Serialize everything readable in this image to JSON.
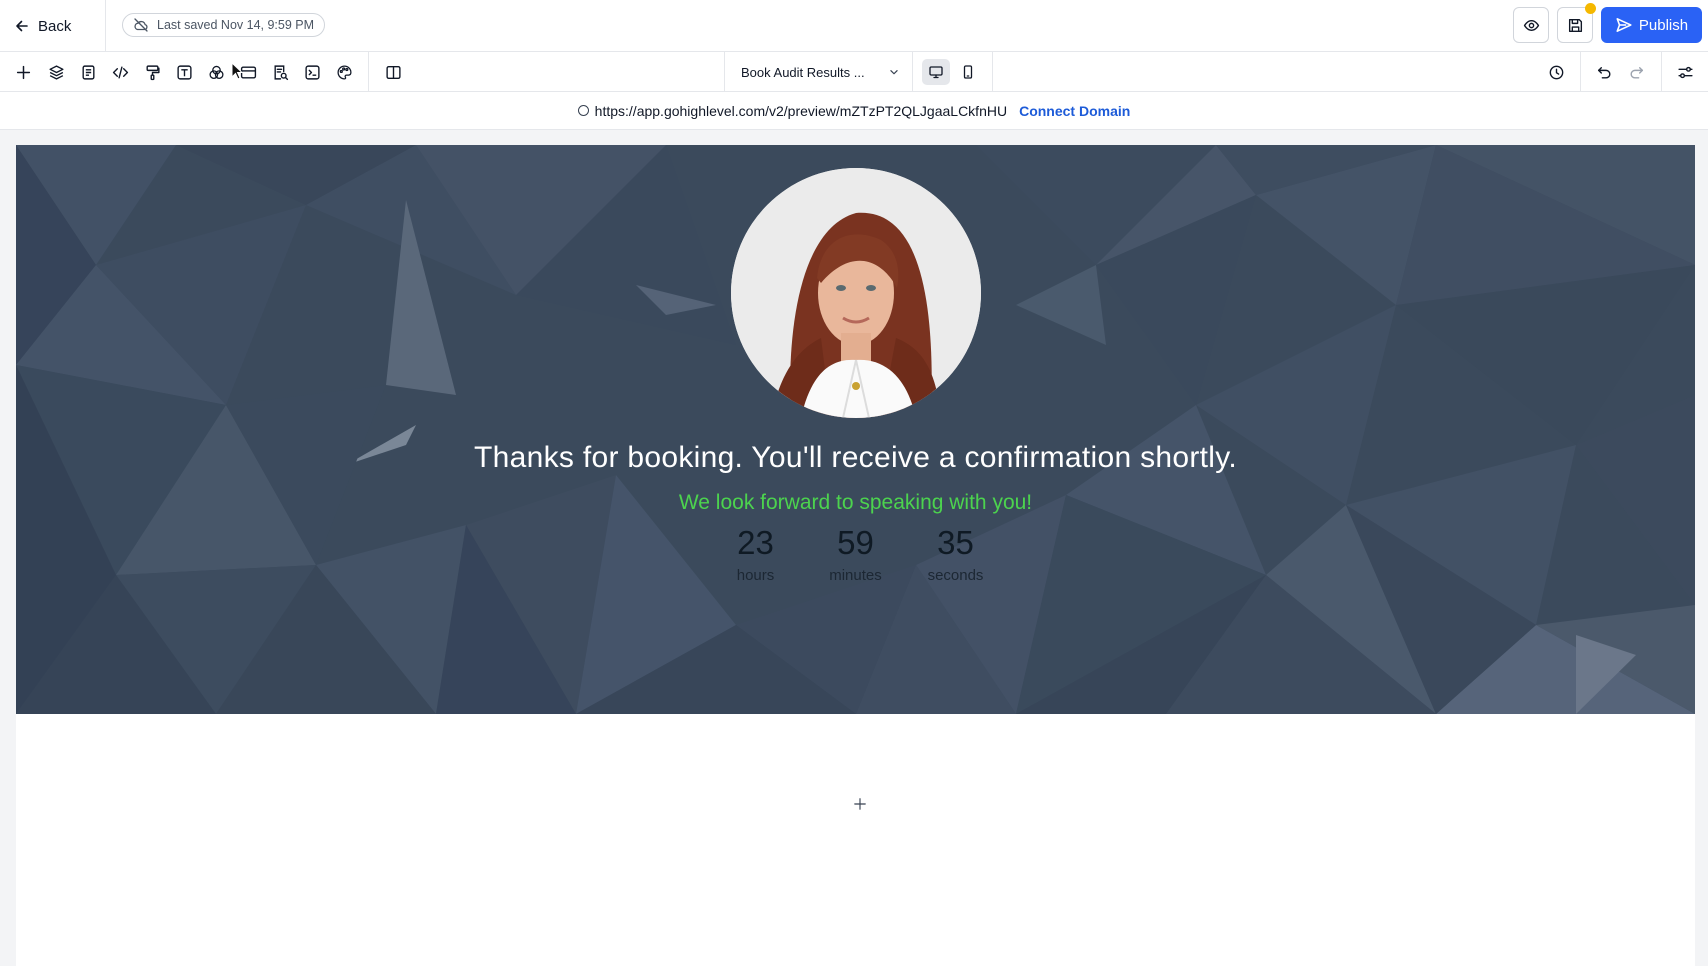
{
  "topbar": {
    "back_label": "Back",
    "saved_status": "Last saved Nov 14, 9:59 PM",
    "publish_label": "Publish"
  },
  "toolbar": {
    "tools": [
      "add-icon",
      "layers-icon",
      "page-icon",
      "code-icon",
      "paint-roller-icon",
      "text-icon",
      "color-circles-icon",
      "card-icon",
      "search-doc-icon",
      "terminal-icon",
      "palette-icon",
      "columns-icon"
    ],
    "page_selector": "Book Audit Results ...",
    "device_active": "desktop"
  },
  "urlbar": {
    "url": "https://app.gohighlevel.com/v2/preview/mZTzPT2QLJgaaLCkfnHU",
    "connect_label": "Connect Domain"
  },
  "hero": {
    "headline": "Thanks for booking. You'll receive a confirmation shortly.",
    "subline": "We look forward to speaking with you!",
    "countdown": [
      {
        "value": "23",
        "label": "hours"
      },
      {
        "value": "59",
        "label": "minutes"
      },
      {
        "value": "35",
        "label": "seconds"
      }
    ]
  },
  "colors": {
    "publish": "#2a62f5",
    "hero_bg": "#3b4a5c",
    "subline": "#4cd34e",
    "link": "#1d5bd8",
    "badge": "#f5b800"
  }
}
